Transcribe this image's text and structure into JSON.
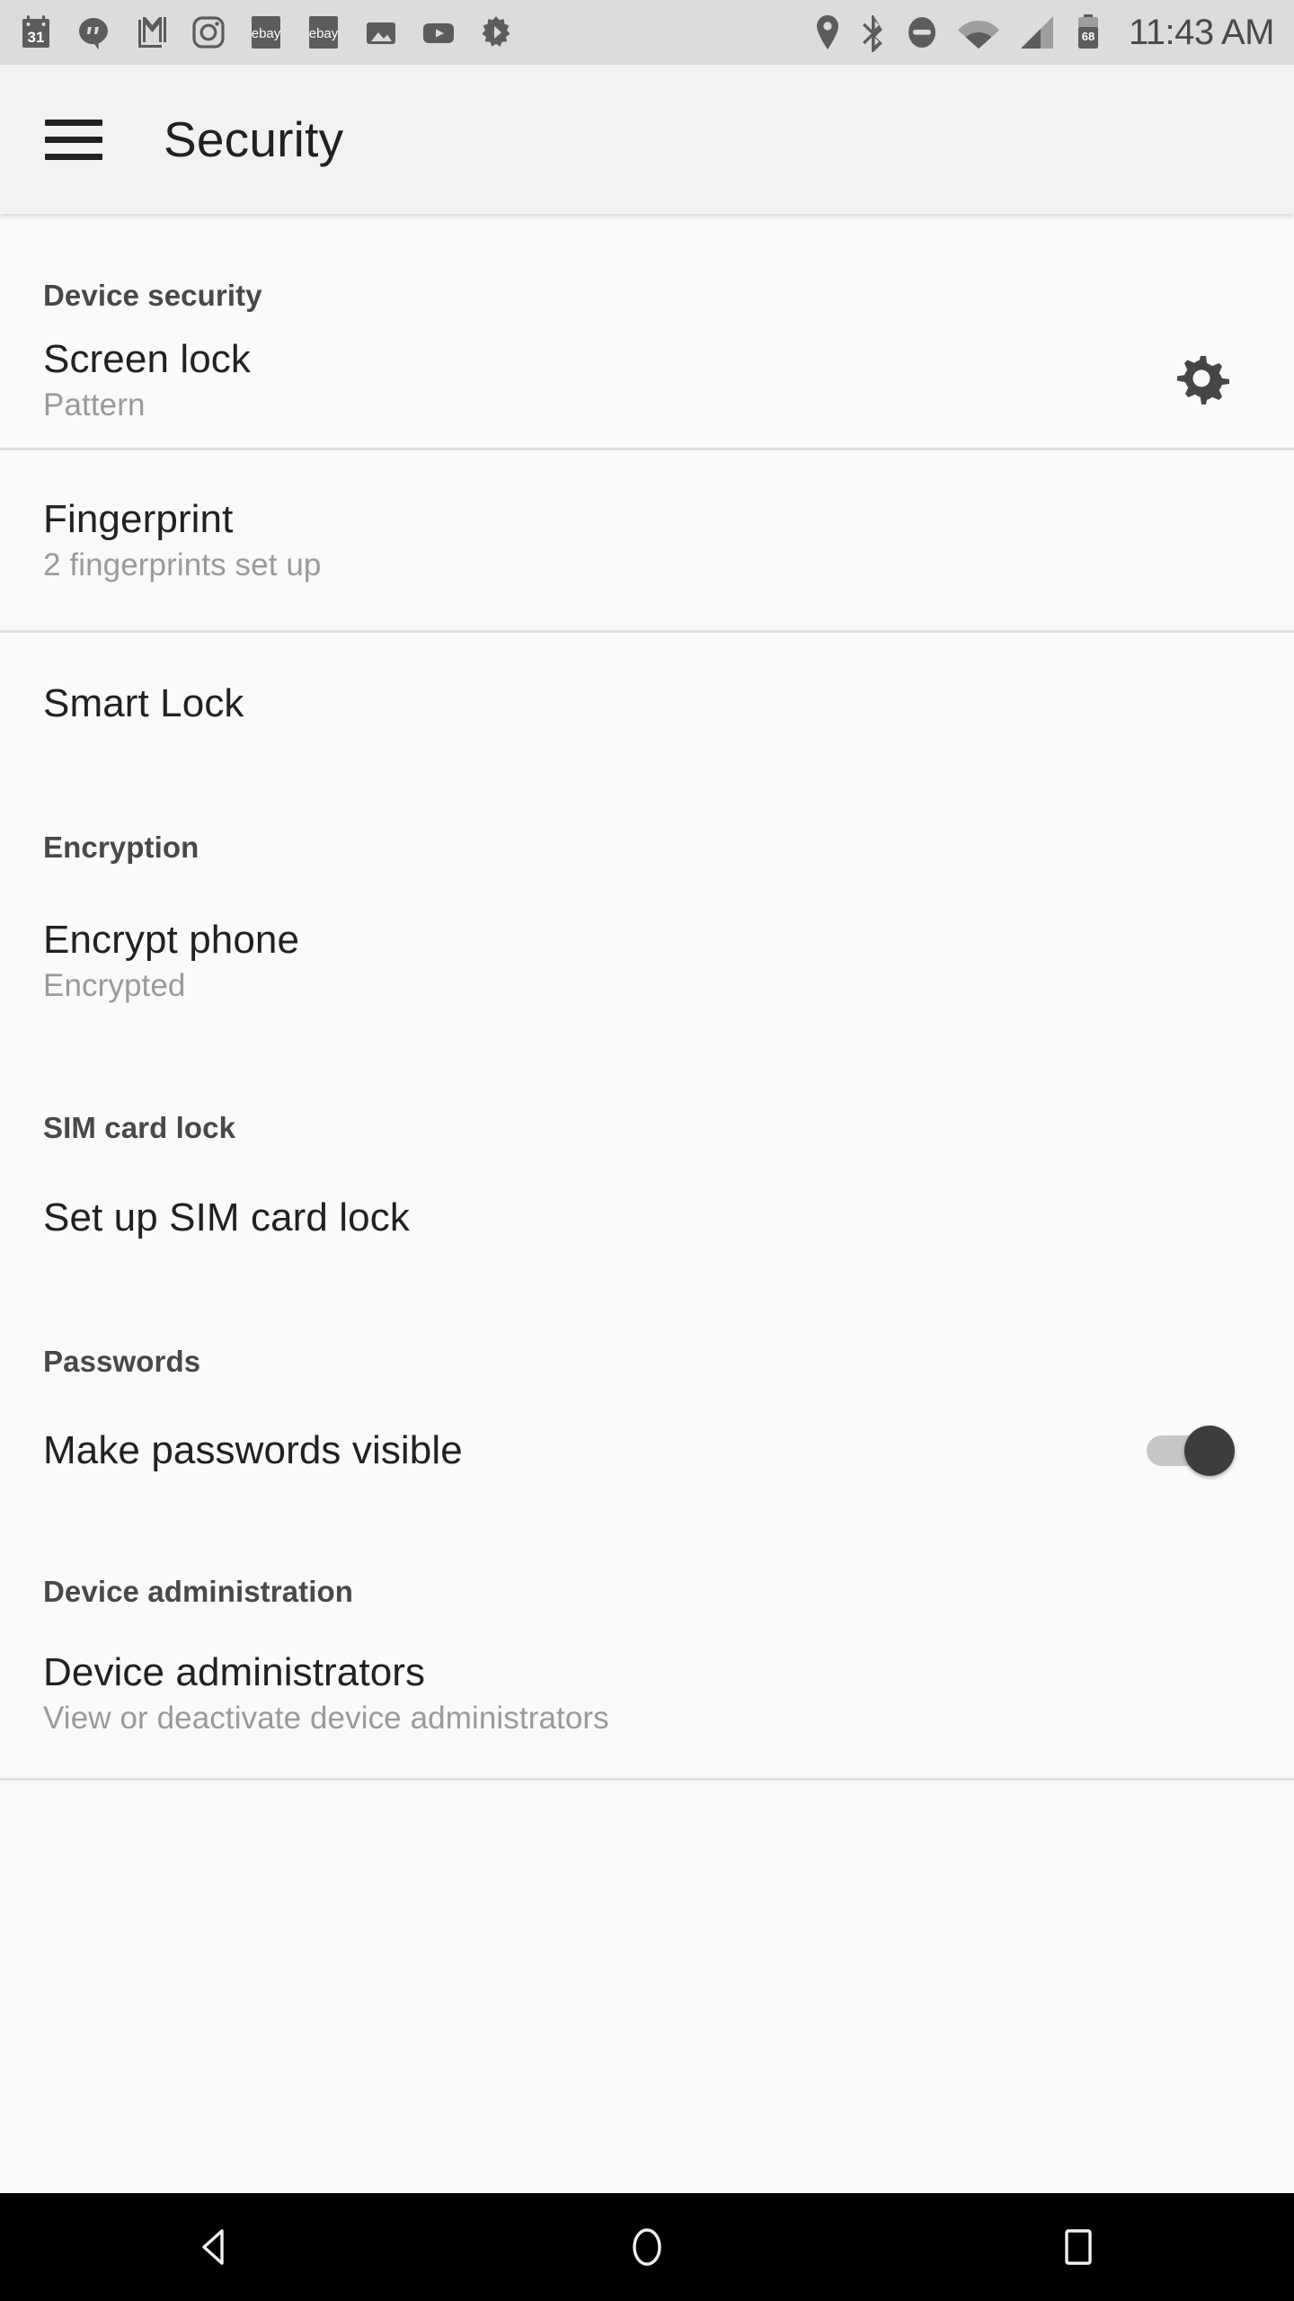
{
  "status_bar": {
    "notification_icons": [
      {
        "name": "calendar-icon",
        "label": "31"
      },
      {
        "name": "hangouts-icon",
        "label": ""
      },
      {
        "name": "gmail-icon",
        "label": ""
      },
      {
        "name": "instagram-icon",
        "label": ""
      },
      {
        "name": "ebay-icon",
        "label": "ebay"
      },
      {
        "name": "ebay-icon-2",
        "label": "ebay"
      },
      {
        "name": "photos-icon",
        "label": ""
      },
      {
        "name": "youtube-icon",
        "label": ""
      },
      {
        "name": "settings-notification-icon",
        "label": ""
      }
    ],
    "system_icons": [
      {
        "name": "location-icon"
      },
      {
        "name": "bluetooth-icon"
      },
      {
        "name": "do-not-disturb-icon"
      },
      {
        "name": "wifi-icon"
      },
      {
        "name": "cellular-signal-icon"
      },
      {
        "name": "battery-icon"
      }
    ],
    "battery_level": "68",
    "time": "11:43 AM"
  },
  "app_bar": {
    "title": "Security",
    "menu_icon": "hamburger-menu-icon"
  },
  "sections": [
    {
      "header": "Device security",
      "rows": [
        {
          "title": "Screen lock",
          "subtitle": "Pattern",
          "accessory": "gear-icon"
        },
        {
          "title": "Fingerprint",
          "subtitle": "2 fingerprints set up",
          "accessory": "none"
        },
        {
          "title": "Smart Lock",
          "subtitle": "",
          "accessory": "none"
        }
      ]
    },
    {
      "header": "Encryption",
      "rows": [
        {
          "title": "Encrypt phone",
          "subtitle": "Encrypted",
          "accessory": "none"
        }
      ]
    },
    {
      "header": "SIM card lock",
      "rows": [
        {
          "title": "Set up SIM card lock",
          "subtitle": "",
          "accessory": "none"
        }
      ]
    },
    {
      "header": "Passwords",
      "rows": [
        {
          "title": "Make passwords visible",
          "subtitle": "",
          "accessory": "toggle",
          "toggle_state": "on"
        }
      ]
    },
    {
      "header": "Device administration",
      "rows": [
        {
          "title": "Device administrators",
          "subtitle": "View or deactivate device administrators",
          "accessory": "none"
        }
      ]
    }
  ],
  "nav_bar": {
    "back": "back-nav-icon",
    "home": "home-nav-icon",
    "recents": "recents-nav-icon"
  },
  "colors": {
    "status_bar_bg": "#dcdcdc",
    "app_bar_bg": "#f2f2f2",
    "page_bg": "#fafafa",
    "primary_text": "#212121",
    "secondary_text": "#9a9a9a",
    "header_text": "#484848",
    "divider": "#e0e0e0",
    "toggle_thumb": "#3d3d3d",
    "toggle_track": "#c6c6c6",
    "nav_bar_bg": "#000000"
  }
}
